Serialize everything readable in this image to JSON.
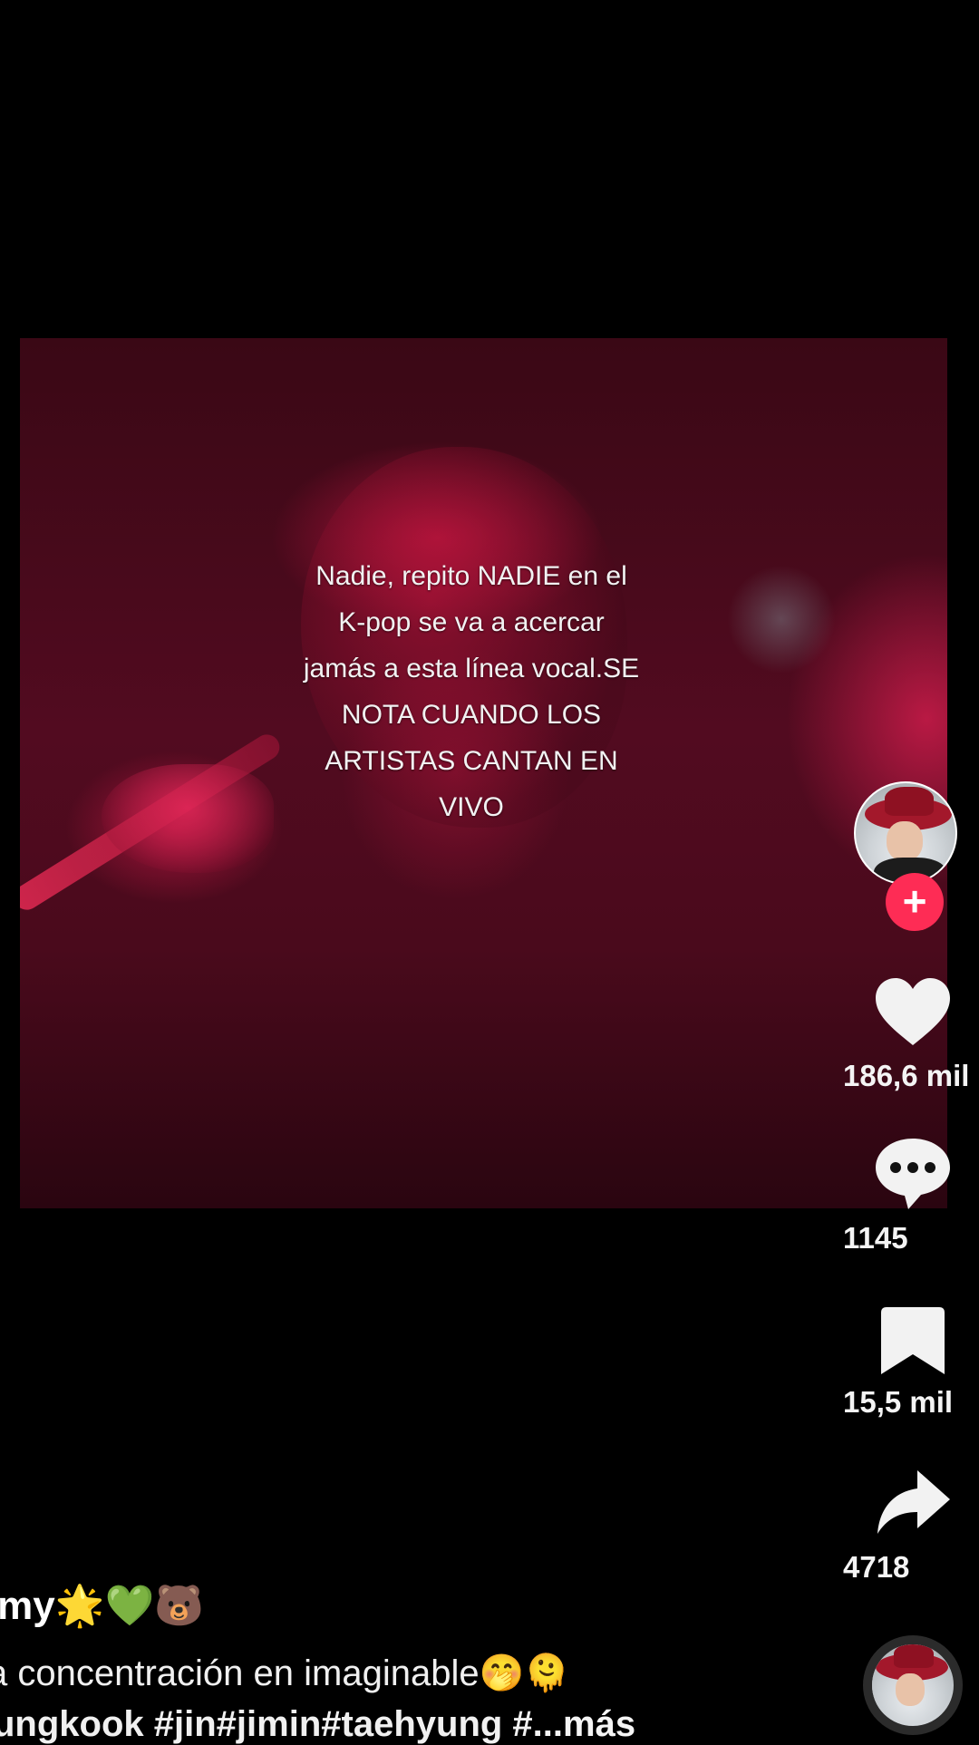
{
  "video": {
    "overlay_lines": [
      "Nadie, repito NADIE en el",
      "K-pop se va a acercar",
      "jamás a esta línea vocal.SE",
      "NOTA CUANDO LOS",
      "ARTISTAS CANTAN EN",
      "VIVO"
    ]
  },
  "actions": {
    "likes": "186,6 mil",
    "comments": "1145",
    "saves": "15,5 mil",
    "shares": "4718",
    "follow_symbol": "+"
  },
  "caption": {
    "username": "rmy🌟💚🐻",
    "line1": "a concentración en imaginable🤭🫠",
    "line2": "ungkook #jin#jimin#taehyung #",
    "more": "...más"
  },
  "icons": {
    "heart": "heart-icon",
    "comment": "comment-icon",
    "bookmark": "bookmark-icon",
    "share": "share-icon"
  },
  "colors": {
    "background": "#000000",
    "follow_accent": "#fe2c55",
    "video_tint": "#520b20"
  }
}
